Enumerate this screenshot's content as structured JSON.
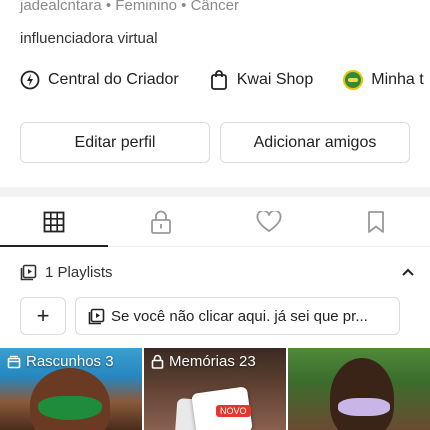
{
  "profile": {
    "meta_line": "jadealcntara • Feminino • Câncer",
    "bio": "influenciadora virtual"
  },
  "shortcuts": [
    {
      "label": "Central do Criador",
      "icon": "lightning-icon"
    },
    {
      "label": "Kwai Shop",
      "icon": "shopping-bag-icon"
    },
    {
      "label": "Minha t",
      "icon": "brazil-badge-icon"
    }
  ],
  "actions": {
    "edit_label": "Editar perfil",
    "add_label": "Adicionar amigos"
  },
  "tabs": [
    {
      "name": "grid-tab",
      "icon": "grid-icon",
      "active": true
    },
    {
      "name": "private-tab",
      "icon": "lock-icon",
      "active": false
    },
    {
      "name": "likes-tab",
      "icon": "heart-icon",
      "active": false
    },
    {
      "name": "saved-tab",
      "icon": "bookmark-icon",
      "active": false
    }
  ],
  "playlists": {
    "header": "1 Playlists",
    "add_label": "+",
    "chip_label": "Se você não clicar aqui. já sei que pr..."
  },
  "grid": [
    {
      "label": "Rascunhos 3",
      "icon": "drafts-icon"
    },
    {
      "label": "Memórias 23",
      "icon": "lock-icon",
      "badge": "NOVO"
    },
    {
      "label": "",
      "icon": ""
    }
  ]
}
